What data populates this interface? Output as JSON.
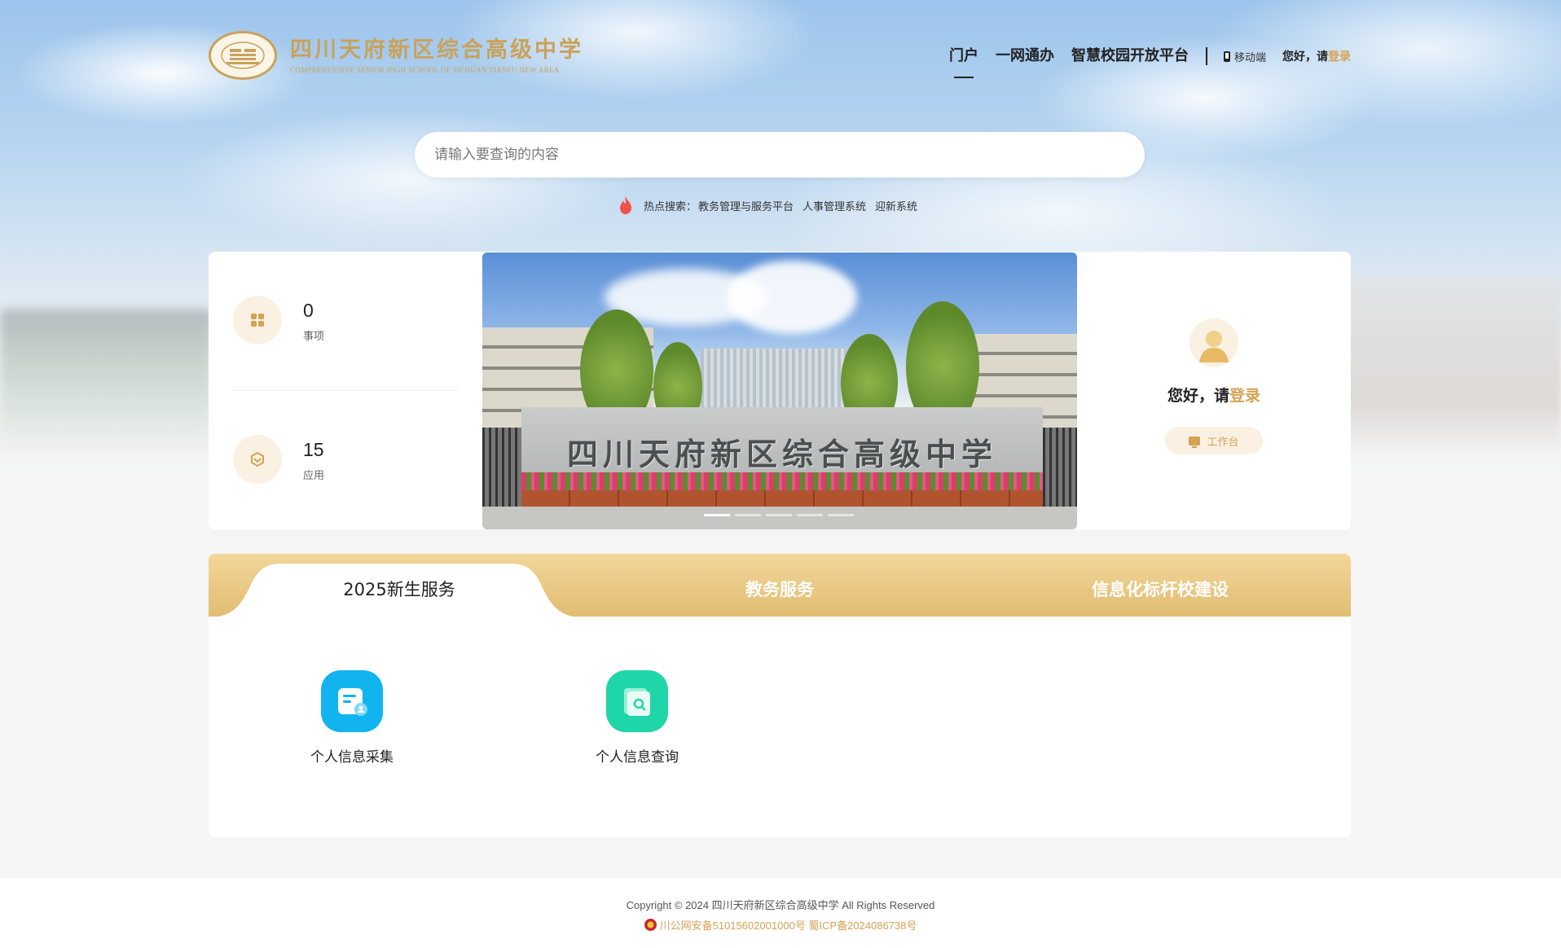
{
  "school": {
    "name_cn": "四川天府新区综合高级中学",
    "name_en": "COMPREHENSIVE SENIOR HIGH SCHOOL OF SICHUAN TIANFU NEW AREA"
  },
  "nav": {
    "items": [
      {
        "label": "门户",
        "active": true
      },
      {
        "label": "一网通办",
        "active": false
      },
      {
        "label": "智慧校园开放平台",
        "active": false
      }
    ],
    "mobile_label": "移动端",
    "greeting": "您好，请",
    "login_label": "登录"
  },
  "search": {
    "placeholder": "请输入要查询的内容",
    "value": ""
  },
  "hot_search": {
    "label": "热点搜索：",
    "links": [
      "教务管理与服务平台",
      "人事管理系统",
      "迎新系统"
    ]
  },
  "stats": [
    {
      "value": "0",
      "label": "事项",
      "icon": "grid-icon"
    },
    {
      "value": "15",
      "label": "应用",
      "icon": "cube-icon"
    }
  ],
  "banner": {
    "caption": "四川天府新区综合高级中学",
    "slides": 5,
    "active_slide": 0
  },
  "user_panel": {
    "greeting": "您好，请",
    "login_label": "登录",
    "workbench_label": "工作台"
  },
  "tabs": [
    {
      "label": "2025新生服务",
      "active": true
    },
    {
      "label": "教务服务",
      "active": false
    },
    {
      "label": "信息化标杆校建设",
      "active": false
    }
  ],
  "services": [
    {
      "label": "个人信息采集",
      "icon": "info-collect-icon",
      "color": "#12b4f0"
    },
    {
      "label": "个人信息查询",
      "icon": "info-query-icon",
      "color": "#1fd6a8"
    }
  ],
  "footer": {
    "copyright": "Copyright © 2024 四川天府新区综合高级中学 All Rights Reserved",
    "icp": "川公网安备51015602001000号 蜀ICP备2024086738号"
  },
  "colors": {
    "accent": "#d4a354",
    "tab_bar": "#e2bd72"
  }
}
